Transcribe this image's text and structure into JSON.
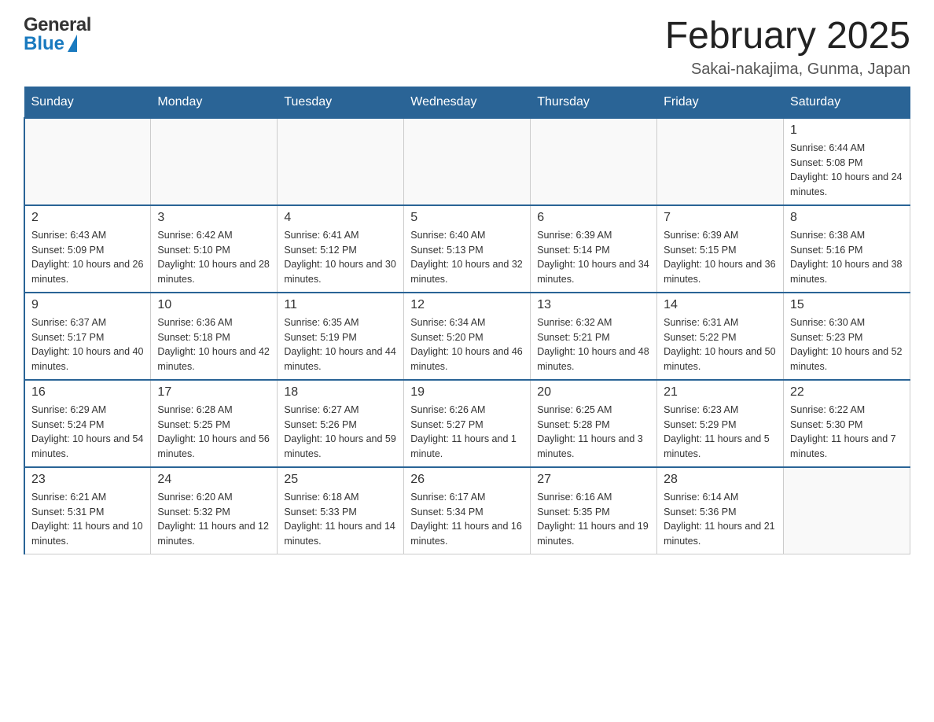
{
  "header": {
    "logo_general": "General",
    "logo_blue": "Blue",
    "title": "February 2025",
    "location": "Sakai-nakajima, Gunma, Japan"
  },
  "weekdays": [
    "Sunday",
    "Monday",
    "Tuesday",
    "Wednesday",
    "Thursday",
    "Friday",
    "Saturday"
  ],
  "weeks": [
    [
      {
        "day": "",
        "info": ""
      },
      {
        "day": "",
        "info": ""
      },
      {
        "day": "",
        "info": ""
      },
      {
        "day": "",
        "info": ""
      },
      {
        "day": "",
        "info": ""
      },
      {
        "day": "",
        "info": ""
      },
      {
        "day": "1",
        "info": "Sunrise: 6:44 AM\nSunset: 5:08 PM\nDaylight: 10 hours and 24 minutes."
      }
    ],
    [
      {
        "day": "2",
        "info": "Sunrise: 6:43 AM\nSunset: 5:09 PM\nDaylight: 10 hours and 26 minutes."
      },
      {
        "day": "3",
        "info": "Sunrise: 6:42 AM\nSunset: 5:10 PM\nDaylight: 10 hours and 28 minutes."
      },
      {
        "day": "4",
        "info": "Sunrise: 6:41 AM\nSunset: 5:12 PM\nDaylight: 10 hours and 30 minutes."
      },
      {
        "day": "5",
        "info": "Sunrise: 6:40 AM\nSunset: 5:13 PM\nDaylight: 10 hours and 32 minutes."
      },
      {
        "day": "6",
        "info": "Sunrise: 6:39 AM\nSunset: 5:14 PM\nDaylight: 10 hours and 34 minutes."
      },
      {
        "day": "7",
        "info": "Sunrise: 6:39 AM\nSunset: 5:15 PM\nDaylight: 10 hours and 36 minutes."
      },
      {
        "day": "8",
        "info": "Sunrise: 6:38 AM\nSunset: 5:16 PM\nDaylight: 10 hours and 38 minutes."
      }
    ],
    [
      {
        "day": "9",
        "info": "Sunrise: 6:37 AM\nSunset: 5:17 PM\nDaylight: 10 hours and 40 minutes."
      },
      {
        "day": "10",
        "info": "Sunrise: 6:36 AM\nSunset: 5:18 PM\nDaylight: 10 hours and 42 minutes."
      },
      {
        "day": "11",
        "info": "Sunrise: 6:35 AM\nSunset: 5:19 PM\nDaylight: 10 hours and 44 minutes."
      },
      {
        "day": "12",
        "info": "Sunrise: 6:34 AM\nSunset: 5:20 PM\nDaylight: 10 hours and 46 minutes."
      },
      {
        "day": "13",
        "info": "Sunrise: 6:32 AM\nSunset: 5:21 PM\nDaylight: 10 hours and 48 minutes."
      },
      {
        "day": "14",
        "info": "Sunrise: 6:31 AM\nSunset: 5:22 PM\nDaylight: 10 hours and 50 minutes."
      },
      {
        "day": "15",
        "info": "Sunrise: 6:30 AM\nSunset: 5:23 PM\nDaylight: 10 hours and 52 minutes."
      }
    ],
    [
      {
        "day": "16",
        "info": "Sunrise: 6:29 AM\nSunset: 5:24 PM\nDaylight: 10 hours and 54 minutes."
      },
      {
        "day": "17",
        "info": "Sunrise: 6:28 AM\nSunset: 5:25 PM\nDaylight: 10 hours and 56 minutes."
      },
      {
        "day": "18",
        "info": "Sunrise: 6:27 AM\nSunset: 5:26 PM\nDaylight: 10 hours and 59 minutes."
      },
      {
        "day": "19",
        "info": "Sunrise: 6:26 AM\nSunset: 5:27 PM\nDaylight: 11 hours and 1 minute."
      },
      {
        "day": "20",
        "info": "Sunrise: 6:25 AM\nSunset: 5:28 PM\nDaylight: 11 hours and 3 minutes."
      },
      {
        "day": "21",
        "info": "Sunrise: 6:23 AM\nSunset: 5:29 PM\nDaylight: 11 hours and 5 minutes."
      },
      {
        "day": "22",
        "info": "Sunrise: 6:22 AM\nSunset: 5:30 PM\nDaylight: 11 hours and 7 minutes."
      }
    ],
    [
      {
        "day": "23",
        "info": "Sunrise: 6:21 AM\nSunset: 5:31 PM\nDaylight: 11 hours and 10 minutes."
      },
      {
        "day": "24",
        "info": "Sunrise: 6:20 AM\nSunset: 5:32 PM\nDaylight: 11 hours and 12 minutes."
      },
      {
        "day": "25",
        "info": "Sunrise: 6:18 AM\nSunset: 5:33 PM\nDaylight: 11 hours and 14 minutes."
      },
      {
        "day": "26",
        "info": "Sunrise: 6:17 AM\nSunset: 5:34 PM\nDaylight: 11 hours and 16 minutes."
      },
      {
        "day": "27",
        "info": "Sunrise: 6:16 AM\nSunset: 5:35 PM\nDaylight: 11 hours and 19 minutes."
      },
      {
        "day": "28",
        "info": "Sunrise: 6:14 AM\nSunset: 5:36 PM\nDaylight: 11 hours and 21 minutes."
      },
      {
        "day": "",
        "info": ""
      }
    ]
  ]
}
